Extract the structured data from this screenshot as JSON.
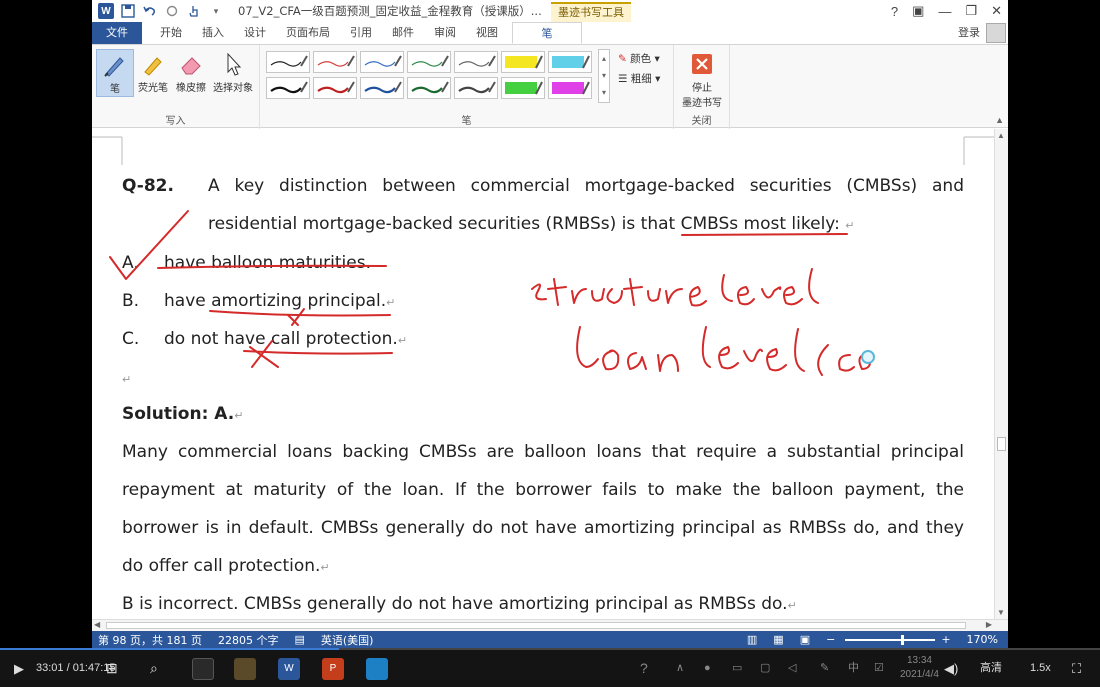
{
  "titlebar": {
    "app_icon": "word-icon",
    "doc_title": "07_V2_CFA一级百题预测_固定收益_金程教育（授课版）...",
    "context_tab": "墨迹书写工具",
    "help": "?",
    "controls": [
      "?",
      "▢",
      "—",
      "❐",
      "✕"
    ]
  },
  "tabs": {
    "file": "文件",
    "items": [
      "开始",
      "插入",
      "设计",
      "页面布局",
      "引用",
      "邮件",
      "审阅",
      "视图"
    ],
    "active": "笔",
    "login": "登录"
  },
  "ribbon": {
    "write_group": {
      "label": "写入",
      "pen": "笔",
      "highlighter": "荧光笔",
      "eraser": "橡皮擦",
      "select": "选择对象"
    },
    "pens_group": {
      "label": "笔",
      "swatch_colors_row1": [
        "#222222",
        "#d04040",
        "#3a6fc0",
        "#2f8a4a",
        "#666666",
        "#f5e622",
        "#5fd0e8"
      ],
      "swatch_colors_row2": [
        "#111111",
        "#c02020",
        "#2050a0",
        "#1a6a30",
        "#444444",
        "#44d040",
        "#e040e8"
      ]
    },
    "color_label": "颜色",
    "weight_label": "粗细",
    "close_group": {
      "label": "关闭",
      "stop_label_1": "停止",
      "stop_label_2": "墨迹书写"
    }
  },
  "document": {
    "question_no": "Q-82.",
    "question_line1": "A key distinction between commercial mortgage-backed securities (CMBSs) and",
    "question_line2": "residential mortgage-backed securities (RMBSs) is that CMBSs most likely:",
    "options": [
      {
        "letter": "A.",
        "text": "have balloon maturities."
      },
      {
        "letter": "B.",
        "text": "have amortizing principal."
      },
      {
        "letter": "C.",
        "text": "do not have call protection."
      }
    ],
    "solution": "Solution: A.",
    "explanation_lines": [
      "Many commercial loans backing CMBSs are balloon loans that require a substantial principal",
      "repayment at maturity of the loan. If the borrower fails to make the balloon payment, the",
      "borrower is in default. CMBSs generally do not have amortizing principal as RMBSs do, and they",
      "do offer call protection."
    ],
    "b_incorrect": "B is incorrect. CMBSs generally do not have amortizing principal as RMBSs do.",
    "ink_note_1": "structure level",
    "ink_note_2": "loan level (co",
    "ink_color": "#d42a2a"
  },
  "statusbar": {
    "page": "第 98 页，共 181 页",
    "words": "22805 个字",
    "lang": "英语(美国)",
    "zoom": "170%"
  },
  "player": {
    "time": "33:01 / 01:47:15",
    "quality": "高清",
    "speed": "1.5x",
    "clock_time": "13:34",
    "clock_date": "2021/4/4",
    "progress": 0.308
  }
}
